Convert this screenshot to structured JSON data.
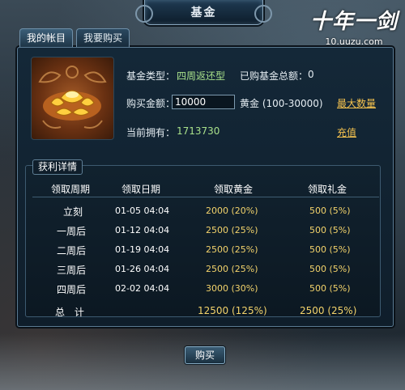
{
  "window": {
    "title": "基金"
  },
  "logo": {
    "mark": "十年一剑",
    "url": "10.uuzu.com"
  },
  "tabs": [
    {
      "label": "我的帐目",
      "active": true
    },
    {
      "label": "我要购买",
      "active": false
    }
  ],
  "info": {
    "fund_type_label": "基金类型：",
    "fund_type_value": "四周返还型",
    "purchased_total_label": "已购基金总额：",
    "purchased_total_value": "0",
    "buy_amount_label": "购买金额：",
    "buy_amount_value": "10000",
    "gold_range": "黄金 (100-30000)",
    "max_link": "最大数量",
    "current_label": "当前拥有：",
    "current_value": "1713730",
    "recharge_link": "充值"
  },
  "details": {
    "label": "获利详情",
    "headers": [
      "领取周期",
      "领取日期",
      "领取黄金",
      "领取礼金"
    ],
    "rows": [
      {
        "period": "立刻",
        "date": "01-05 04:04",
        "gold": "2000 (20%)",
        "gift": "500 (5%)"
      },
      {
        "period": "一周后",
        "date": "01-12 04:04",
        "gold": "2500 (25%)",
        "gift": "500 (5%)"
      },
      {
        "period": "二周后",
        "date": "01-19 04:04",
        "gold": "2500 (25%)",
        "gift": "500 (5%)"
      },
      {
        "period": "三周后",
        "date": "01-26 04:04",
        "gold": "2500 (25%)",
        "gift": "500 (5%)"
      },
      {
        "period": "四周后",
        "date": "02-02 04:04",
        "gold": "3000 (30%)",
        "gift": "500 (5%)"
      }
    ],
    "total": {
      "label": "总 计",
      "gold": "12500 (125%)",
      "gift": "2500 (25%)"
    }
  },
  "buy_button": "购买",
  "colors": {
    "accent_gold": "#f3d36b",
    "link": "#f4c24e",
    "value_green": "#a8e08a"
  }
}
